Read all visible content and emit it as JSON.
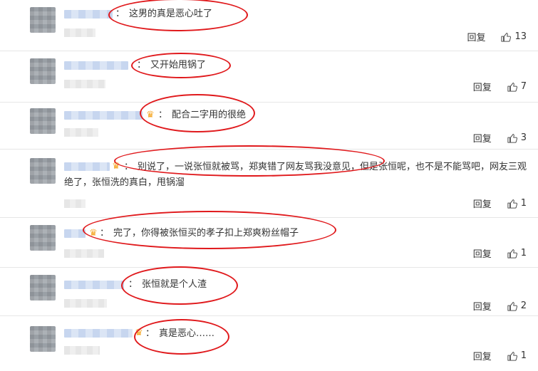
{
  "reply_label": "回复",
  "comments": [
    {
      "text": "这男的真是恶心吐了",
      "likes": "13"
    },
    {
      "text": "又开始甩锅了",
      "likes": "7"
    },
    {
      "text": "配合二字用的很绝",
      "likes": "3"
    },
    {
      "text": "别说了，一说张恒就被骂，郑爽错了网友骂我没意见，但是张恒呢，也不是不能骂吧，网友三观绝了，张恒洗的真白，甩锅溜",
      "likes": "1"
    },
    {
      "text": "完了，你得被张恒买的孝子扣上郑爽粉丝帽子",
      "likes": "1"
    },
    {
      "text": "张恒就是个人渣",
      "likes": "2"
    },
    {
      "text": "真是恶心……",
      "likes": "1"
    }
  ],
  "colon": "：",
  "icons": {
    "like": "thumbs-up-icon",
    "badge": "crown-badge-icon"
  },
  "colors": {
    "highlight": "#e0191c",
    "text": "#333333"
  }
}
